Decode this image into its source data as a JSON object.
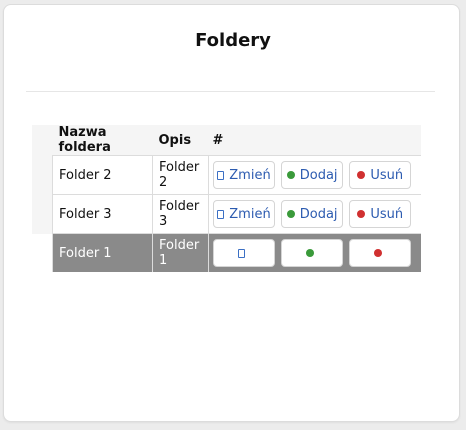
{
  "page": {
    "title": "Foldery"
  },
  "table": {
    "headers": [
      "Nazwa foldera",
      "Opis",
      "#"
    ],
    "rows": [
      {
        "name": "Folder 2",
        "desc": "Folder 2",
        "edit": "Zmień",
        "add": "Dodaj",
        "delete": "Usuń"
      },
      {
        "name": "Folder 3",
        "desc": "Folder 3",
        "edit": "Zmień",
        "add": "Dodaj",
        "delete": "Usuń"
      },
      {
        "name": "Folder 1",
        "desc": "Folder 1",
        "edit": "",
        "add": "",
        "delete": ""
      }
    ]
  },
  "colors": {
    "selected_row": "#8a8a8a",
    "link": "#2c5bb0",
    "add": "#3a9a3a",
    "delete": "#d03030"
  }
}
